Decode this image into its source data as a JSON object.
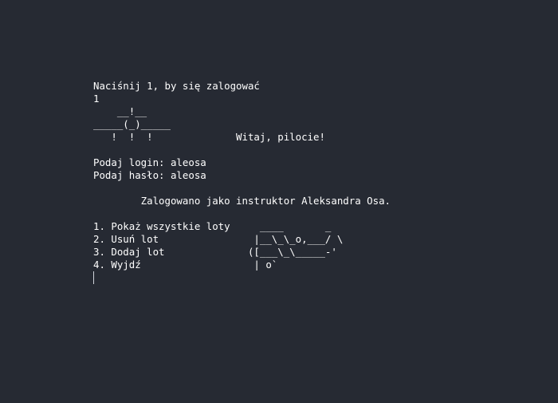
{
  "terminal": {
    "lines": [
      "Naciśnij 1, by się zalogować",
      "1",
      "    __!__",
      "_____(_)_____",
      "   !  !  !              Witaj, pilocie!",
      "",
      "Podaj login: aleosa",
      "Podaj hasło: aleosa",
      "",
      "        Zalogowano jako instruktor Aleksandra Osa.",
      "",
      "1. Pokaż wszystkie loty     ____       _",
      "2. Usuń lot                |__\\_\\_o,___/ \\",
      "3. Dodaj lot              ([___\\_\\_____-'",
      "4. Wyjdź                   | o`"
    ]
  }
}
